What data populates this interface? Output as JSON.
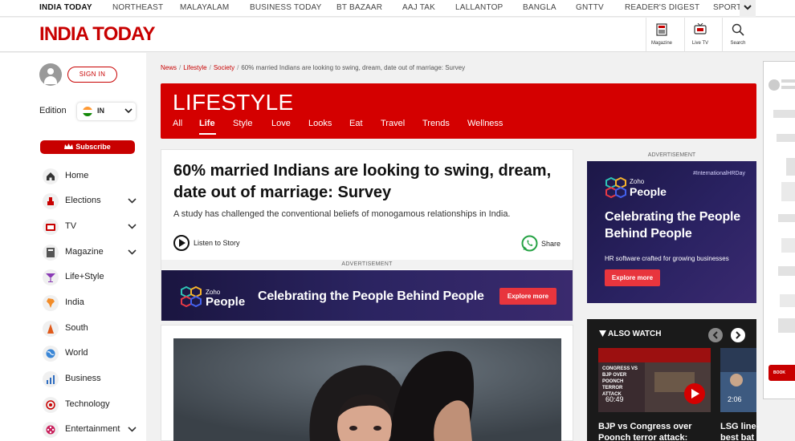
{
  "network": {
    "items": [
      "INDIA TODAY",
      "NORTHEAST",
      "MALAYALAM",
      "BUSINESS TODAY",
      "BT BAZAAR",
      "AAJ TAK",
      "LALLANTOP",
      "BANGLA",
      "GNTTV",
      "READER'S DIGEST",
      "SPORTS"
    ]
  },
  "header": {
    "logo": "INDIA TODAY",
    "icons": [
      {
        "label": "Magazine",
        "icon": "magazine-icon"
      },
      {
        "label": "Live TV",
        "icon": "live-tv-icon"
      },
      {
        "label": "Search",
        "icon": "search-icon"
      }
    ]
  },
  "sidebar": {
    "sign_in": "SIGN IN",
    "edition_label": "Edition",
    "edition_code": "IN",
    "subscribe": "Subscribe",
    "items": [
      {
        "label": "Home",
        "expandable": false
      },
      {
        "label": "Elections",
        "expandable": true
      },
      {
        "label": "TV",
        "expandable": true
      },
      {
        "label": "Magazine",
        "expandable": true
      },
      {
        "label": "Life+Style",
        "expandable": false
      },
      {
        "label": "India",
        "expandable": false
      },
      {
        "label": "South",
        "expandable": false
      },
      {
        "label": "World",
        "expandable": false
      },
      {
        "label": "Business",
        "expandable": false
      },
      {
        "label": "Technology",
        "expandable": false
      },
      {
        "label": "Entertainment",
        "expandable": true
      }
    ]
  },
  "breadcrumb": {
    "items": [
      "News",
      "Lifestyle",
      "Society"
    ],
    "current": "60% married Indians are looking to swing, dream, date out of marriage: Survey"
  },
  "section": {
    "title": "LIFESTYLE",
    "tabs": [
      "All",
      "Life",
      "Style",
      "Love",
      "Looks",
      "Eat",
      "Travel",
      "Trends",
      "Wellness"
    ],
    "active_tab": "Life"
  },
  "article": {
    "headline": "60% married Indians are looking to swing, dream, date out of marriage: Survey",
    "summary": "A study has challenged the conventional beliefs of monogamous relationships in India.",
    "listen_label": "Listen to Story",
    "share_label": "Share"
  },
  "ads": {
    "label": "ADVERTISEMENT",
    "banner": {
      "brand_small": "Zoho",
      "brand_big": "People",
      "text": "Celebrating the People Behind People",
      "cta": "Explore more"
    },
    "square": {
      "brand_small": "Zoho",
      "brand_big": "People",
      "tag": "#InternationalHRDay",
      "headline": "Celebrating the People Behind People",
      "sub": "HR software crafted for growing businesses",
      "cta": "Explore more"
    },
    "far_right": {
      "cta": "BOOK"
    }
  },
  "also_watch": {
    "title": "ALSO WATCH",
    "videos": [
      {
        "duration": "60:49",
        "overlay": "CONGRESS VS BJP OVER POONCH TERROR ATTACK",
        "caption_lines": [
          "BJP vs Congress over",
          "Poonch terror attack:"
        ]
      },
      {
        "duration": "2:06",
        "caption_lines": [
          "LSG line-",
          "best bat"
        ]
      }
    ]
  },
  "colors": {
    "brand_red": "#c80000",
    "section_red": "#d40000",
    "ad_purple": "#2a2262",
    "ad_cta": "#e8353d"
  }
}
